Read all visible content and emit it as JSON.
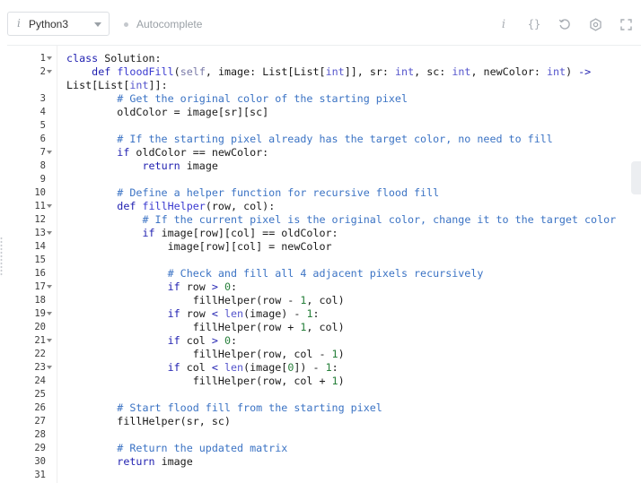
{
  "toolbar": {
    "language": "Python3",
    "language_info_glyph": "i",
    "autocomplete_label": "Autocomplete",
    "icons": [
      "info-icon",
      "braces-icon",
      "reset-icon",
      "settings-icon",
      "fullscreen-icon"
    ],
    "info_glyph": "i",
    "braces_glyph": "{}"
  },
  "colors": {
    "keyword": "#1f1fb0",
    "comment": "#3b73c4",
    "number": "#267f3a",
    "line_number": "#3c3c3c"
  },
  "editor": {
    "line_numbers": [
      "1",
      "2",
      "",
      "3",
      "4",
      "5",
      "6",
      "7",
      "8",
      "9",
      "10",
      "11",
      "12",
      "13",
      "14",
      "15",
      "16",
      "17",
      "18",
      "19",
      "20",
      "21",
      "22",
      "23",
      "24",
      "25",
      "26",
      "27",
      "28",
      "29",
      "30",
      "31"
    ],
    "fold_lines": [
      "1",
      "2",
      "7",
      "11",
      "13",
      "17",
      "19",
      "21",
      "23"
    ],
    "lines": [
      [
        {
          "t": "class",
          "c": "kw"
        },
        {
          "t": " Solution:"
        }
      ],
      [
        {
          "t": "    "
        },
        {
          "t": "def",
          "c": "kw"
        },
        {
          "t": " "
        },
        {
          "t": "floodFill",
          "c": "fn"
        },
        {
          "t": "("
        },
        {
          "t": "self",
          "c": "slf"
        },
        {
          "t": ", image: List[List["
        },
        {
          "t": "int",
          "c": "bi"
        },
        {
          "t": "]], sr: "
        },
        {
          "t": "int",
          "c": "bi"
        },
        {
          "t": ", sc: "
        },
        {
          "t": "int",
          "c": "bi"
        },
        {
          "t": ", newColor: "
        },
        {
          "t": "int",
          "c": "bi"
        },
        {
          "t": ") "
        },
        {
          "t": "->",
          "c": "kw"
        }
      ],
      [
        {
          "t": "List[List["
        },
        {
          "t": "int",
          "c": "bi"
        },
        {
          "t": "]]:"
        }
      ],
      [
        {
          "t": "        "
        },
        {
          "t": "# Get the original color of the starting pixel",
          "c": "cm"
        }
      ],
      [
        {
          "t": "        oldColor = image[sr][sc]"
        }
      ],
      [
        {
          "t": ""
        }
      ],
      [
        {
          "t": "        "
        },
        {
          "t": "# If the starting pixel already has the target color, no need to fill",
          "c": "cm"
        }
      ],
      [
        {
          "t": "        "
        },
        {
          "t": "if",
          "c": "kw"
        },
        {
          "t": " oldColor == newColor:"
        }
      ],
      [
        {
          "t": "            "
        },
        {
          "t": "return",
          "c": "kw"
        },
        {
          "t": " image"
        }
      ],
      [
        {
          "t": ""
        }
      ],
      [
        {
          "t": "        "
        },
        {
          "t": "# Define a helper function for recursive flood fill",
          "c": "cm"
        }
      ],
      [
        {
          "t": "        "
        },
        {
          "t": "def",
          "c": "kw"
        },
        {
          "t": " "
        },
        {
          "t": "fillHelper",
          "c": "fn"
        },
        {
          "t": "(row, col):"
        }
      ],
      [
        {
          "t": "            "
        },
        {
          "t": "# If the current pixel is the original color, change it to the target color",
          "c": "cm"
        }
      ],
      [
        {
          "t": "            "
        },
        {
          "t": "if",
          "c": "kw"
        },
        {
          "t": " image[row][col] == oldColor:"
        }
      ],
      [
        {
          "t": "                image[row][col] = newColor"
        }
      ],
      [
        {
          "t": ""
        }
      ],
      [
        {
          "t": "                "
        },
        {
          "t": "# Check and fill all 4 adjacent pixels recursively",
          "c": "cm"
        }
      ],
      [
        {
          "t": "                "
        },
        {
          "t": "if",
          "c": "kw"
        },
        {
          "t": " row "
        },
        {
          "t": ">",
          "c": "kw"
        },
        {
          "t": " "
        },
        {
          "t": "0",
          "c": "num"
        },
        {
          "t": ":"
        }
      ],
      [
        {
          "t": "                    fillHelper(row - "
        },
        {
          "t": "1",
          "c": "num"
        },
        {
          "t": ", col)"
        }
      ],
      [
        {
          "t": "                "
        },
        {
          "t": "if",
          "c": "kw"
        },
        {
          "t": " row "
        },
        {
          "t": "<",
          "c": "kw"
        },
        {
          "t": " "
        },
        {
          "t": "len",
          "c": "bi"
        },
        {
          "t": "(image) - "
        },
        {
          "t": "1",
          "c": "num"
        },
        {
          "t": ":"
        }
      ],
      [
        {
          "t": "                    fillHelper(row + "
        },
        {
          "t": "1",
          "c": "num"
        },
        {
          "t": ", col)"
        }
      ],
      [
        {
          "t": "                "
        },
        {
          "t": "if",
          "c": "kw"
        },
        {
          "t": " col "
        },
        {
          "t": ">",
          "c": "kw"
        },
        {
          "t": " "
        },
        {
          "t": "0",
          "c": "num"
        },
        {
          "t": ":"
        }
      ],
      [
        {
          "t": "                    fillHelper(row, col - "
        },
        {
          "t": "1",
          "c": "num"
        },
        {
          "t": ")"
        }
      ],
      [
        {
          "t": "                "
        },
        {
          "t": "if",
          "c": "kw"
        },
        {
          "t": " col "
        },
        {
          "t": "<",
          "c": "kw"
        },
        {
          "t": " "
        },
        {
          "t": "len",
          "c": "bi"
        },
        {
          "t": "(image["
        },
        {
          "t": "0",
          "c": "num"
        },
        {
          "t": "]) - "
        },
        {
          "t": "1",
          "c": "num"
        },
        {
          "t": ":"
        }
      ],
      [
        {
          "t": "                    fillHelper(row, col + "
        },
        {
          "t": "1",
          "c": "num"
        },
        {
          "t": ")"
        }
      ],
      [
        {
          "t": ""
        }
      ],
      [
        {
          "t": "        "
        },
        {
          "t": "# Start flood fill from the starting pixel",
          "c": "cm"
        }
      ],
      [
        {
          "t": "        fillHelper(sr, sc)"
        }
      ],
      [
        {
          "t": ""
        }
      ],
      [
        {
          "t": "        "
        },
        {
          "t": "# Return the updated matrix",
          "c": "cm"
        }
      ],
      [
        {
          "t": "        "
        },
        {
          "t": "return",
          "c": "kw"
        },
        {
          "t": " image"
        }
      ],
      [
        {
          "t": ""
        }
      ]
    ]
  }
}
